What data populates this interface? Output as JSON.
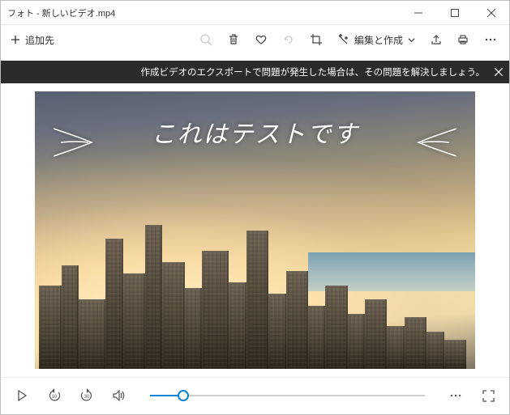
{
  "window": {
    "title": "フォト - 新しいビデオ.mp4"
  },
  "toolbar": {
    "addto_label": "追加先",
    "edit_label": "編集と作成"
  },
  "banner": {
    "text": "作成ビデオのエクスポートで問題が発生した場合は、その問題を解決しましょう。"
  },
  "video": {
    "overlay_text": "これはテストです"
  },
  "playback": {
    "skip_back": "10",
    "skip_fwd": "30",
    "progress_pct": 12
  }
}
